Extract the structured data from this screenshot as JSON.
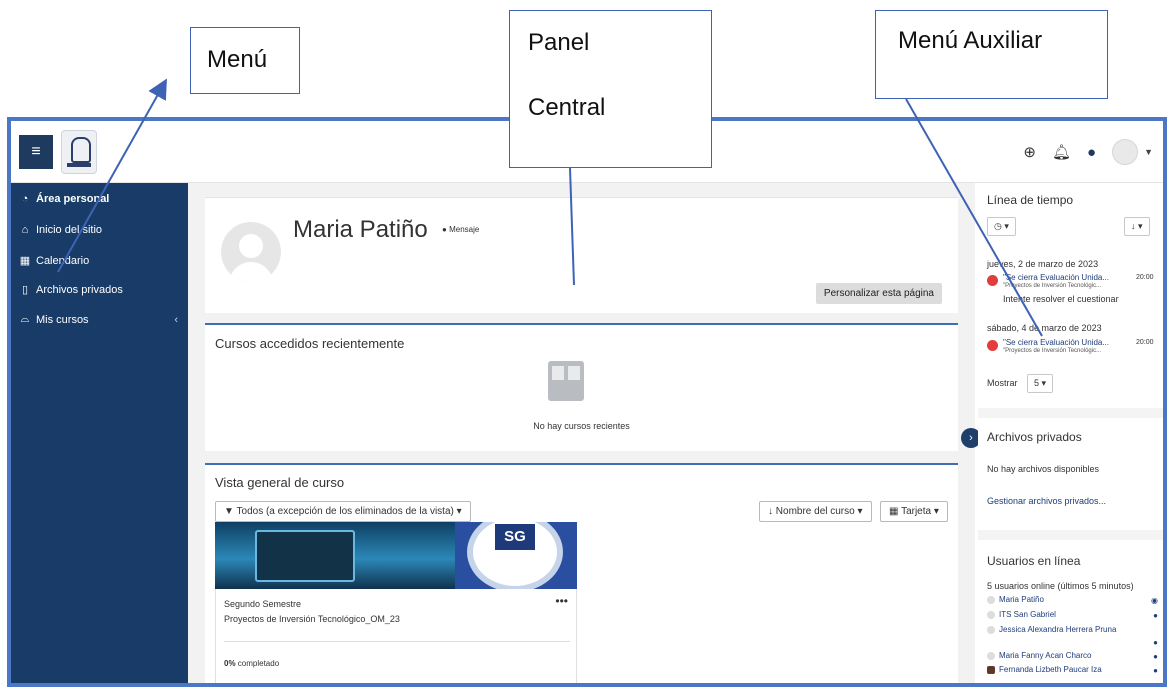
{
  "callouts": {
    "menu": "Menú",
    "panel_line1": "Panel",
    "panel_line2": "Central",
    "aux": "Menú Auxiliar"
  },
  "topbar": {
    "menu_icon": "hamburger-icon",
    "icons": [
      "globe-icon",
      "bell-icon",
      "chat-icon",
      "user-avatar"
    ]
  },
  "sidebar": {
    "items": [
      {
        "icon": "dashboard-icon",
        "label": "Área personal"
      },
      {
        "icon": "home-icon",
        "label": "Inicio del sitio"
      },
      {
        "icon": "calendar-icon",
        "label": "Calendario"
      },
      {
        "icon": "file-icon",
        "label": "Archivos privados"
      },
      {
        "icon": "graduation-cap-icon",
        "label": "Mis cursos"
      }
    ]
  },
  "profile": {
    "name": "Maria Patiño",
    "message_label": "Mensaje",
    "customize_label": "Personalizar esta página"
  },
  "recent": {
    "title": "Cursos accedidos recientemente",
    "empty_text": "No hay cursos recientes"
  },
  "overview": {
    "title": "Vista general de curso",
    "filter_label": "Todos (a excepción de los eliminados de la vista)",
    "sort_label": "Nombre del curso",
    "view_label": "Tarjeta",
    "course": {
      "category": "Segundo Semestre",
      "name": "Proyectos de Inversión Tecnológico_OM_23",
      "logo_text": "SG",
      "progress_pct": "0%",
      "progress_suffix": " completado"
    }
  },
  "timeline": {
    "title": "Línea de tiempo",
    "events": [
      {
        "date": "jueves, 2 de marzo de 2023",
        "title": "\"Se cierra Evaluación Unida...",
        "subtitle": "\"Proyectos de Inversión Tecnológic...",
        "time": "20:00",
        "action": "Intente resolver el cuestionar"
      },
      {
        "date": "sábado, 4 de marzo de 2023",
        "title": "\"Se cierra Evaluación Unida...",
        "subtitle": "\"Proyectos de Inversión Tecnológic...",
        "time": "20:00",
        "action": ""
      }
    ],
    "show_label": "Mostrar",
    "show_value": "5"
  },
  "files": {
    "title": "Archivos privados",
    "empty_text": "No hay archivos disponibles",
    "manage_link": "Gestionar archivos privados..."
  },
  "online": {
    "title": "Usuarios en línea",
    "count": "5 usuarios online (últimos 5 minutos)",
    "users": [
      {
        "name": "Maria Patiño",
        "action_icon": "eye-icon"
      },
      {
        "name": "ITS San Gabriel",
        "action_icon": "chat-icon"
      },
      {
        "name": "Jessica Alexandra Herrera Pruna",
        "action_icon": "chat-icon"
      },
      {
        "name": "Maria Fanny Acan Charco",
        "action_icon": "chat-icon"
      },
      {
        "name": "Fernanda Lizbeth Paucar Iza",
        "action_icon": "chat-icon"
      }
    ]
  }
}
